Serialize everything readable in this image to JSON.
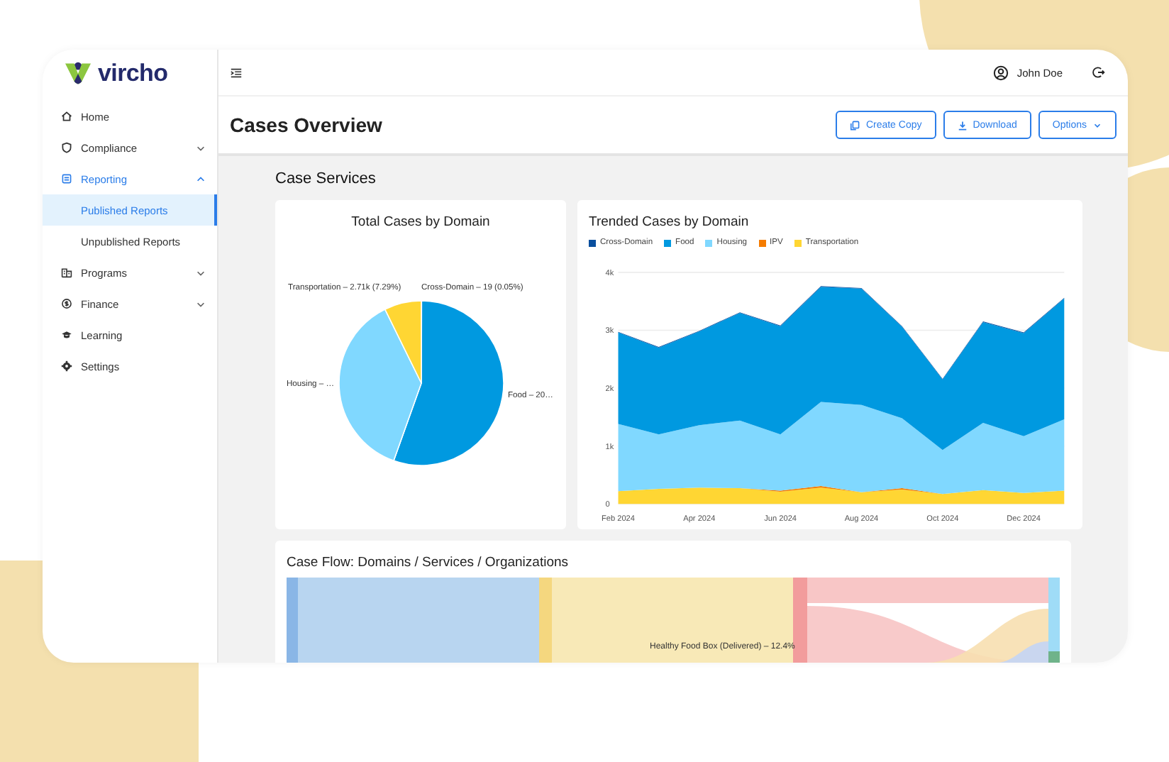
{
  "brand": {
    "name": "vircho"
  },
  "sidebar": {
    "items": [
      {
        "label": "Home",
        "selected": false
      },
      {
        "label": "Compliance",
        "expanded": false,
        "selected": false
      },
      {
        "label": "Reporting",
        "expanded": true,
        "selected": true,
        "children": [
          {
            "label": "Published Reports",
            "selected": true
          },
          {
            "label": "Unpublished Reports",
            "selected": false
          }
        ]
      },
      {
        "label": "Programs",
        "expanded": false,
        "selected": false
      },
      {
        "label": "Finance",
        "expanded": false,
        "selected": false
      },
      {
        "label": "Learning",
        "selected": false
      },
      {
        "label": "Settings",
        "selected": false
      }
    ]
  },
  "user": {
    "name": "John Doe"
  },
  "page": {
    "title": "Cases Overview",
    "buttons": [
      {
        "label": "Create Copy"
      },
      {
        "label": "Download"
      },
      {
        "label": "Options"
      }
    ]
  },
  "section": {
    "title": "Case Services"
  },
  "total": {
    "title": "Total Cases by Domain",
    "labels": [
      "Cross-Domain – 19 (0.05%)",
      "Food – 20…",
      "Housing – …",
      "Transportation – 2.71k (7.29%)"
    ]
  },
  "trended": {
    "chart_data": {
      "type": "area",
      "title": "Trended Cases by Domain",
      "stacked": true,
      "categories": [
        "Feb 2024",
        null,
        "Apr 2024",
        null,
        "Jun 2024",
        null,
        "Aug 2024",
        null,
        "Oct 2024",
        null,
        "Dec 2024",
        null
      ],
      "ylim": [
        0,
        4000
      ],
      "yticks": [
        {
          "value": 0,
          "label": "0"
        },
        {
          "value": 1000,
          "label": "1k"
        },
        {
          "value": 2000,
          "label": "2k"
        },
        {
          "value": 3000,
          "label": "3k"
        },
        {
          "value": 4000,
          "label": "4k"
        }
      ],
      "series": [
        {
          "name": "Transportation",
          "color": "#ffd633",
          "values": [
            220,
            260,
            280,
            270,
            210,
            280,
            200,
            250,
            170,
            240,
            190,
            230
          ]
        },
        {
          "name": "IPV",
          "color": "#f57c00",
          "values": [
            0,
            0,
            0,
            0,
            20,
            30,
            0,
            20,
            0,
            0,
            0,
            0
          ]
        },
        {
          "name": "Housing",
          "color": "#80d8ff",
          "values": [
            1160,
            940,
            1080,
            1170,
            970,
            1450,
            1510,
            1210,
            760,
            1160,
            980,
            1230
          ]
        },
        {
          "name": "Food",
          "color": "#0099e0",
          "values": [
            1580,
            1500,
            1620,
            1860,
            1870,
            1990,
            2010,
            1580,
            1220,
            1740,
            1780,
            2090
          ]
        },
        {
          "name": "Cross-Domain",
          "color": "#0a4f9e",
          "values": [
            10,
            10,
            10,
            10,
            10,
            10,
            10,
            10,
            10,
            10,
            10,
            10
          ]
        }
      ]
    }
  },
  "flow": {
    "title": "Case Flow: Domains / Services / Organizations",
    "node_label": "Healthy Food Box (Delivered) – 12.4%"
  }
}
